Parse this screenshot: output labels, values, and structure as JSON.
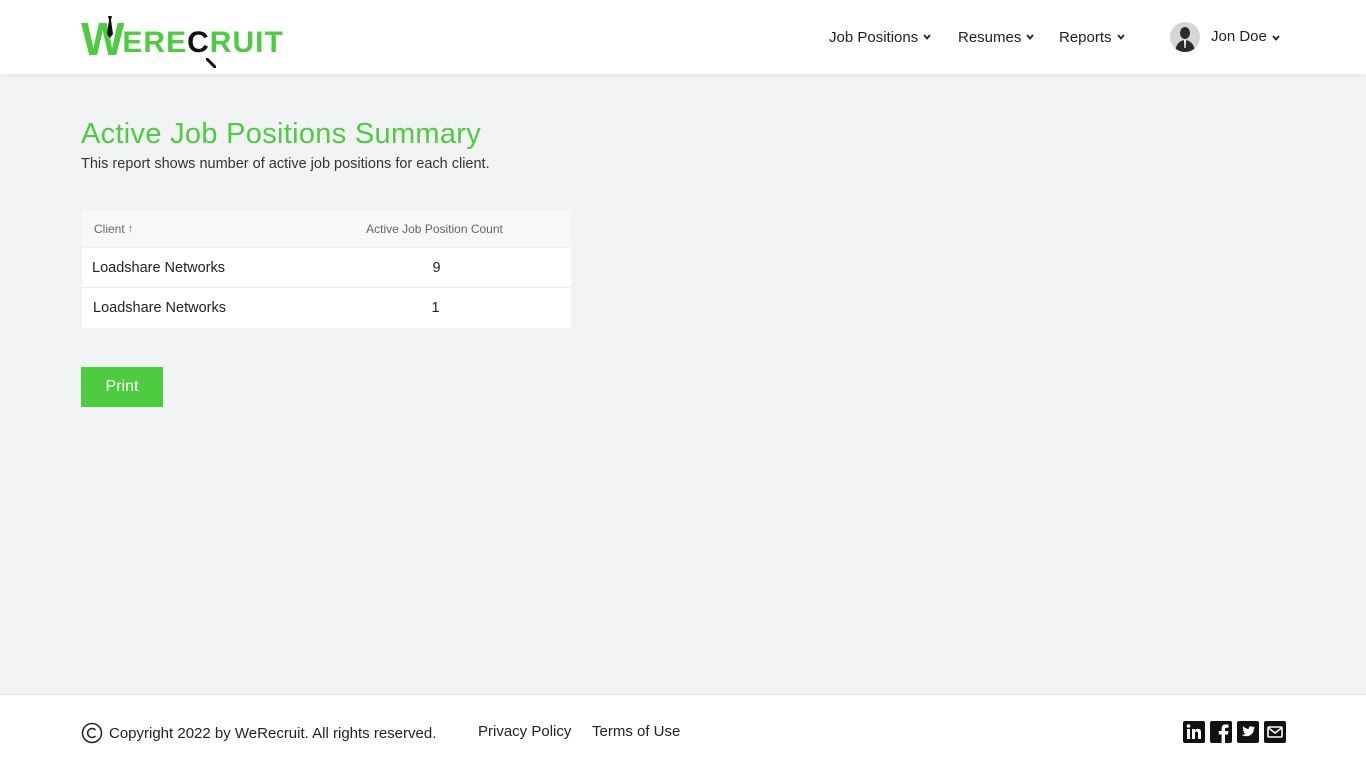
{
  "brand": {
    "logo_w": "W",
    "logo_mid": "ERE",
    "logo_c": "C",
    "logo_end": "RUIT",
    "accent": "#4ccc3e"
  },
  "nav": {
    "job_positions": "Job Positions",
    "resumes": "Resumes",
    "reports": "Reports",
    "user_name": "Jon Doe"
  },
  "page": {
    "title": "Active Job Positions Summary",
    "subtitle": "This report shows number of active job positions for each client."
  },
  "table": {
    "headers": {
      "client": "Client",
      "sort_indicator": "↑",
      "count": "Active Job Position Count"
    },
    "rows": [
      {
        "client": "Loadshare Networks",
        "count": "9"
      },
      {
        "client": "Loadshare Networks",
        "count": "1"
      }
    ]
  },
  "actions": {
    "print": "Print"
  },
  "footer": {
    "copyright": "Copyright 2022 by WeRecruit. All rights reserved.",
    "privacy": "Privacy Policy",
    "terms": "Terms of Use",
    "social_icons": [
      "linkedin-icon",
      "facebook-icon",
      "twitter-icon",
      "email-icon"
    ]
  }
}
